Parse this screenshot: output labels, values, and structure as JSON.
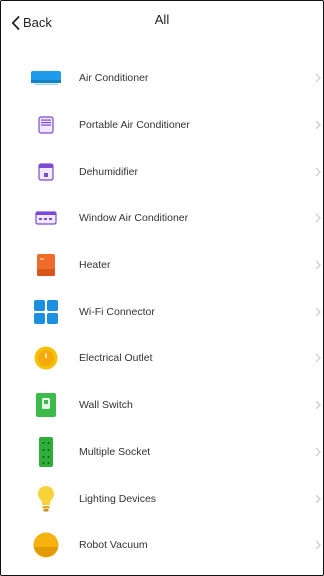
{
  "header": {
    "back_label": "Back",
    "title": "All"
  },
  "devices": [
    {
      "label": "Air Conditioner",
      "icon": "air-conditioner-icon"
    },
    {
      "label": "Portable Air Conditioner",
      "icon": "portable-air-conditioner-icon"
    },
    {
      "label": "Dehumidifier",
      "icon": "dehumidifier-icon"
    },
    {
      "label": "Window Air Conditioner",
      "icon": "window-air-conditioner-icon"
    },
    {
      "label": "Heater",
      "icon": "heater-icon"
    },
    {
      "label": "Wi-Fi Connector",
      "icon": "wifi-connector-icon"
    },
    {
      "label": "Electrical Outlet",
      "icon": "electrical-outlet-icon"
    },
    {
      "label": "Wall Switch",
      "icon": "wall-switch-icon"
    },
    {
      "label": "Multiple Socket",
      "icon": "multiple-socket-icon"
    },
    {
      "label": "Lighting Devices",
      "icon": "lighting-devices-icon"
    },
    {
      "label": "Robot Vacuum",
      "icon": "robot-vacuum-icon"
    }
  ],
  "colors": {
    "ac_blue": "#1f9be9",
    "purple": "#7b4bd3",
    "heater_orange": "#f06a2a",
    "wifi_blue": "#1c8fe0",
    "outlet_yellow": "#f5c20a",
    "switch_green": "#3dbb4a",
    "socket_green": "#2fae3a",
    "bulb_yellow": "#f8d23a",
    "vacuum_orange": "#f6b20f",
    "chevron_gray": "#c8c8c8"
  }
}
